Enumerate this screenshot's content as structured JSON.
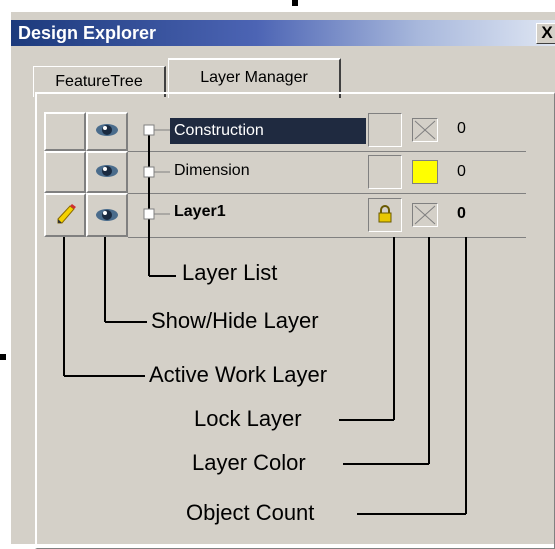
{
  "window": {
    "title": "Design Explorer",
    "close_label": "X"
  },
  "tabs": [
    {
      "label": "FeatureTree"
    },
    {
      "label": "Layer Manager"
    }
  ],
  "layers": [
    {
      "name": "Construction",
      "count": "0",
      "selected": true,
      "bold": false,
      "active": false,
      "visible": true,
      "locked": false,
      "color": "none"
    },
    {
      "name": "Dimension",
      "count": "0",
      "selected": false,
      "bold": false,
      "active": false,
      "visible": true,
      "locked": false,
      "color": "#ffff00"
    },
    {
      "name": "Layer1",
      "count": "0",
      "selected": false,
      "bold": true,
      "active": true,
      "visible": true,
      "locked": true,
      "color": "none"
    }
  ],
  "callouts": {
    "layer_list": "Layer List",
    "show_hide": "Show/Hide Layer",
    "active_work": "Active Work Layer",
    "lock": "Lock Layer",
    "color": "Layer Color",
    "count": "Object Count"
  }
}
